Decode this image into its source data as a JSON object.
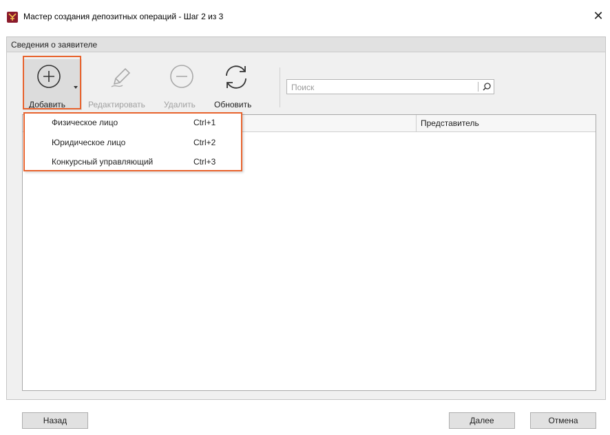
{
  "window": {
    "title": "Мастер создания депозитных операций - Шаг 2 из 3",
    "close_symbol": "✕",
    "app_icon": "app-logo-icon",
    "brand_color": "#8b1a2b"
  },
  "section": {
    "header": "Сведения о заявителе"
  },
  "toolbar": {
    "add_label": "Добавить",
    "edit_label": "Редактировать",
    "delete_label": "Удалить",
    "refresh_label": "Обновить",
    "add_icon": "plus-circle-icon",
    "edit_icon": "pencil-icon",
    "delete_icon": "minus-circle-icon",
    "refresh_icon": "refresh-icon"
  },
  "search": {
    "placeholder": "Поиск",
    "icon": "search-icon"
  },
  "grid": {
    "columns": [
      "Представитель"
    ]
  },
  "add_menu": {
    "items": [
      {
        "label": "Физическое лицо",
        "shortcut": "Ctrl+1"
      },
      {
        "label": "Юридическое лицо",
        "shortcut": "Ctrl+2"
      },
      {
        "label": "Конкурсный управляющий",
        "shortcut": "Ctrl+3"
      }
    ]
  },
  "footer": {
    "back_label": "Назад",
    "next_label": "Далее",
    "cancel_label": "Отмена"
  },
  "colors": {
    "highlight": "#e8622c",
    "disabled_text": "#a0a0a0"
  }
}
